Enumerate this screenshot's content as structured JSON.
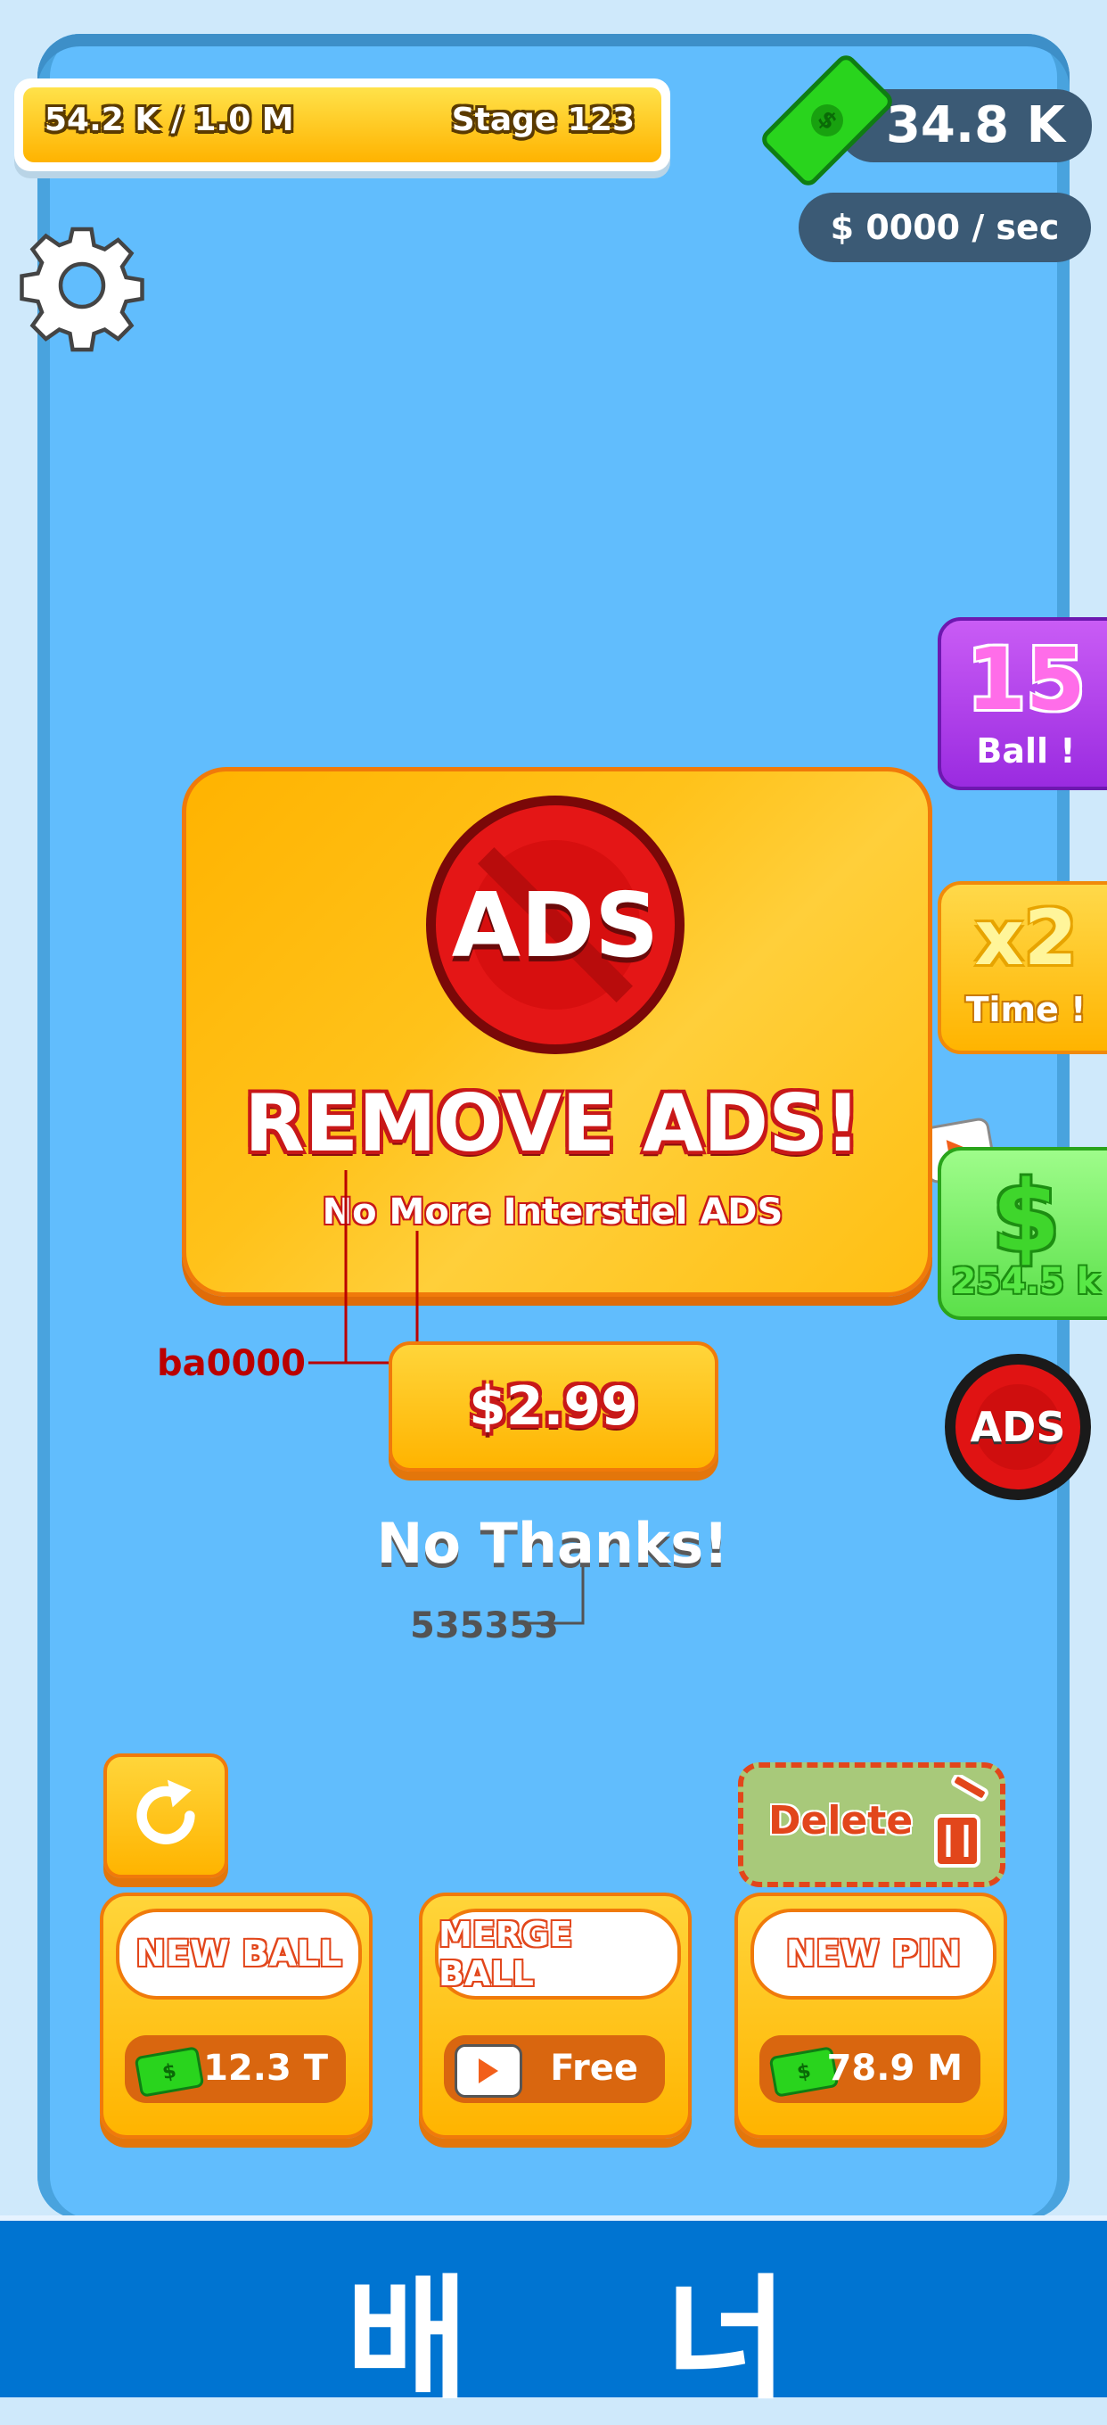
{
  "top": {
    "progress_text": "54.2 K / 1.0 M",
    "stage_text": "Stage 123",
    "money_total": "34.8 K",
    "money_rate": "$ 0000 / sec"
  },
  "side": {
    "ball_count": "15",
    "ball_label": "Ball !",
    "time_multiplier": "x2",
    "time_label": "Time !",
    "cash_value": "254.5 k",
    "ads_icon_text": "ADS"
  },
  "popup": {
    "ads_badge": "ADS",
    "title": "REMOVE ADS!",
    "subtitle": "No More Interstiel ADS",
    "price": "$2.99",
    "no_thanks": "No Thanks!"
  },
  "annotations": {
    "red_color": "ba0000",
    "gray_color": "535353"
  },
  "bottom": {
    "delete_label": "Delete",
    "buttons": [
      {
        "label": "NEW BALL",
        "cost": "12.3 T",
        "icon": "cash-icon"
      },
      {
        "label": "MERGE BALL",
        "cost": "Free",
        "icon": "play-icon"
      },
      {
        "label": "NEW PIN",
        "cost": "78.9 M",
        "icon": "cash-icon"
      }
    ]
  },
  "banner": {
    "text_left": "배",
    "text_right": "너"
  },
  "colors": {
    "board": "#61bdfd",
    "yellow": "#ffc107",
    "banner": "#0074d1",
    "accent_red": "#ba0000"
  }
}
